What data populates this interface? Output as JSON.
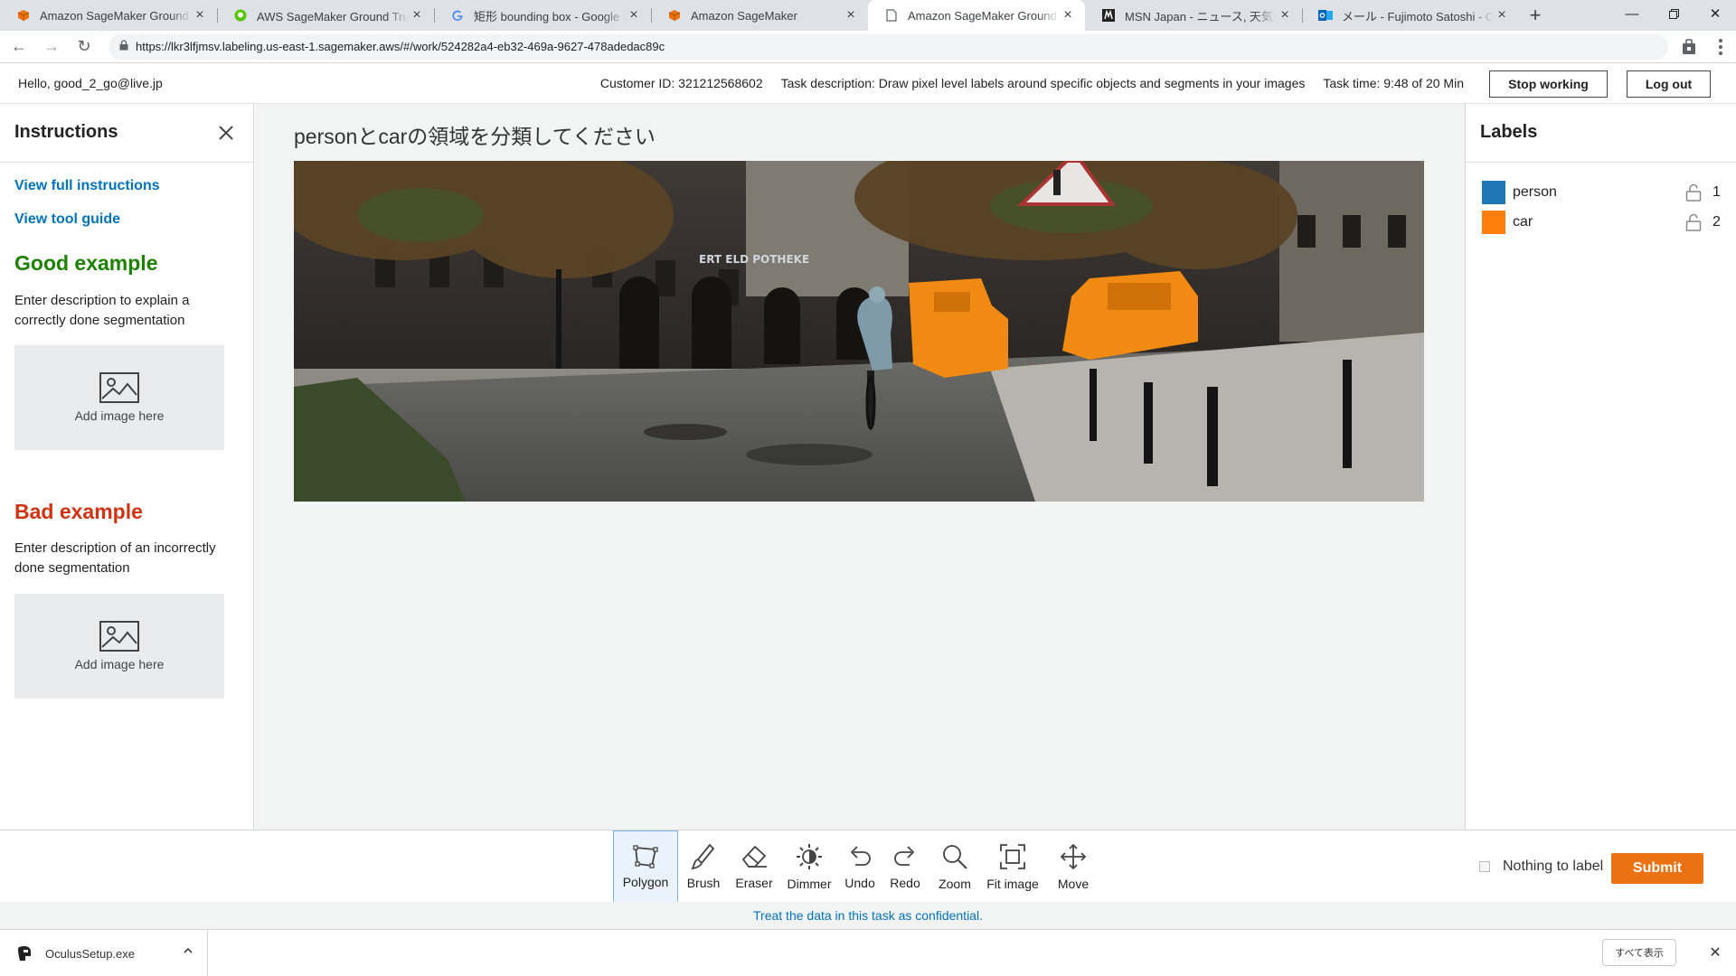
{
  "browser": {
    "tabs": [
      {
        "title": "Amazon SageMaker Ground Truth",
        "favicon": "aws-cube-icon",
        "active": false
      },
      {
        "title": "AWS SageMaker Ground Truthで",
        "favicon": "qiita-icon",
        "active": false
      },
      {
        "title": "矩形 bounding box - Google 検索",
        "favicon": "google-icon",
        "active": false
      },
      {
        "title": "Amazon SageMaker",
        "favicon": "aws-cube-icon",
        "active": false
      },
      {
        "title": "Amazon SageMaker Ground Truth",
        "favicon": "page-icon",
        "active": true
      },
      {
        "title": "MSN Japan - ニュース, 天気, メール",
        "favicon": "msn-icon",
        "active": false
      },
      {
        "title": "メール - Fujimoto Satoshi - Outlook",
        "favicon": "outlook-icon",
        "active": false
      }
    ],
    "url": "https://lkr3lfjmsv.labeling.us-east-1.sagemaker.aws/#/work/524282a4-eb32-469a-9627-478adedac89c"
  },
  "header": {
    "greeting": "Hello, good_2_go@live.jp",
    "customer_id": "Customer ID: 321212568602",
    "task_description": "Task description: Draw pixel level labels around specific objects and segments in your images",
    "task_time": "Task time: 9:48 of 20 Min",
    "stop_label": "Stop working",
    "logout_label": "Log out"
  },
  "instructions": {
    "title": "Instructions",
    "view_full": "View full instructions",
    "view_guide": "View tool guide",
    "good_title": "Good example",
    "good_desc": "Enter description to explain a correctly done segmentation",
    "bad_title": "Bad example",
    "bad_desc": "Enter description of an incorrectly done segmentation",
    "add_image": "Add image here"
  },
  "task": {
    "prompt": "personとcarの領域を分類してください",
    "storefront_sign": "ERT    ELD  POTHEKE"
  },
  "labels": {
    "title": "Labels",
    "items": [
      {
        "name": "person",
        "key": "1",
        "color": "#1f77b4"
      },
      {
        "name": "car",
        "key": "2",
        "color": "#ff7f0e"
      }
    ]
  },
  "tools": {
    "items": [
      {
        "label": "Polygon",
        "icon": "polygon-icon",
        "active": true
      },
      {
        "label": "Brush",
        "icon": "brush-icon",
        "active": false
      },
      {
        "label": "Eraser",
        "icon": "eraser-icon",
        "active": false
      },
      {
        "label": "Dimmer",
        "icon": "dimmer-icon",
        "active": false
      },
      {
        "label": "Undo",
        "icon": "undo-icon",
        "active": false
      },
      {
        "label": "Redo",
        "icon": "redo-icon",
        "active": false
      },
      {
        "label": "Zoom",
        "icon": "zoom-icon",
        "active": false
      },
      {
        "label": "Fit image",
        "icon": "fit-image-icon",
        "active": false
      },
      {
        "label": "Move",
        "icon": "move-icon",
        "active": false
      }
    ],
    "nothing_to_label": "Nothing to label",
    "submit": "Submit"
  },
  "footer": {
    "confidential": "Treat the data in this task as confidential."
  },
  "downloads": {
    "file": "OculusSetup.exe",
    "show_all": "すべて表示"
  },
  "colors": {
    "accent": "#ec7211",
    "link": "#0073bb",
    "good": "#1d8102",
    "bad": "#d13212",
    "person_label": "#1f77b4",
    "car_label": "#ff7f0e"
  }
}
